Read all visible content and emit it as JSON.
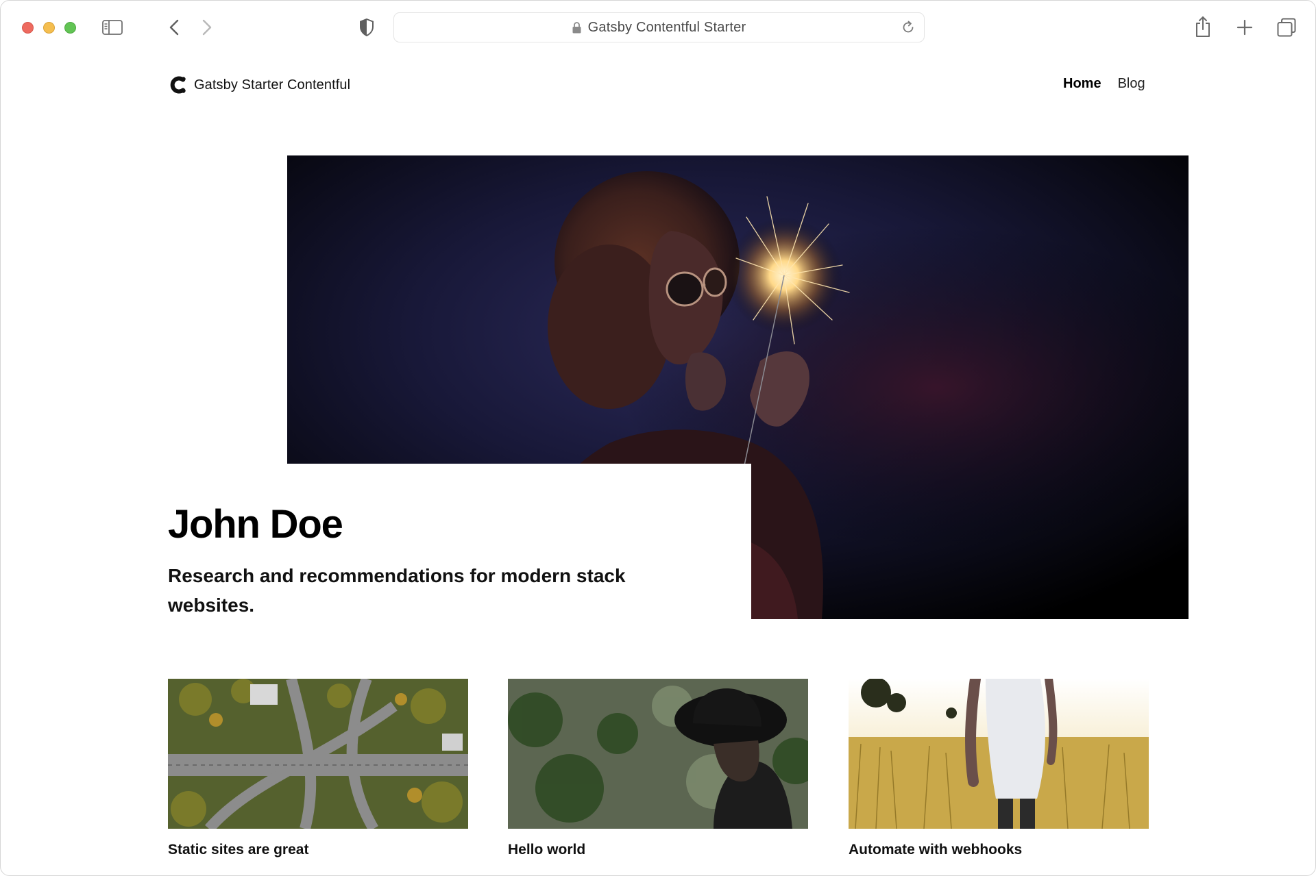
{
  "browser": {
    "address_text": "Gatsby Contentful Starter",
    "icons": {
      "sidebar": "sidebar-icon",
      "back": "chevron-left-icon",
      "forward": "chevron-right-icon",
      "privacy": "shield-icon",
      "lock": "lock-icon",
      "reload": "reload-icon",
      "share": "share-icon",
      "new_tab": "plus-icon",
      "tab_overview": "tabs-icon"
    },
    "colors": {
      "close": "#ee6a5f",
      "minimize": "#f5be4f",
      "zoom": "#62c454"
    }
  },
  "site": {
    "brand_name": "Gatsby Starter Contentful",
    "nav": [
      {
        "label": "Home",
        "active": true
      },
      {
        "label": "Blog",
        "active": false
      }
    ]
  },
  "hero": {
    "title": "John Doe",
    "subtitle": "Research and recommendations for modern stack websites."
  },
  "posts": [
    {
      "title": "Static sites are great"
    },
    {
      "title": "Hello world"
    },
    {
      "title": "Automate with webhooks"
    }
  ]
}
